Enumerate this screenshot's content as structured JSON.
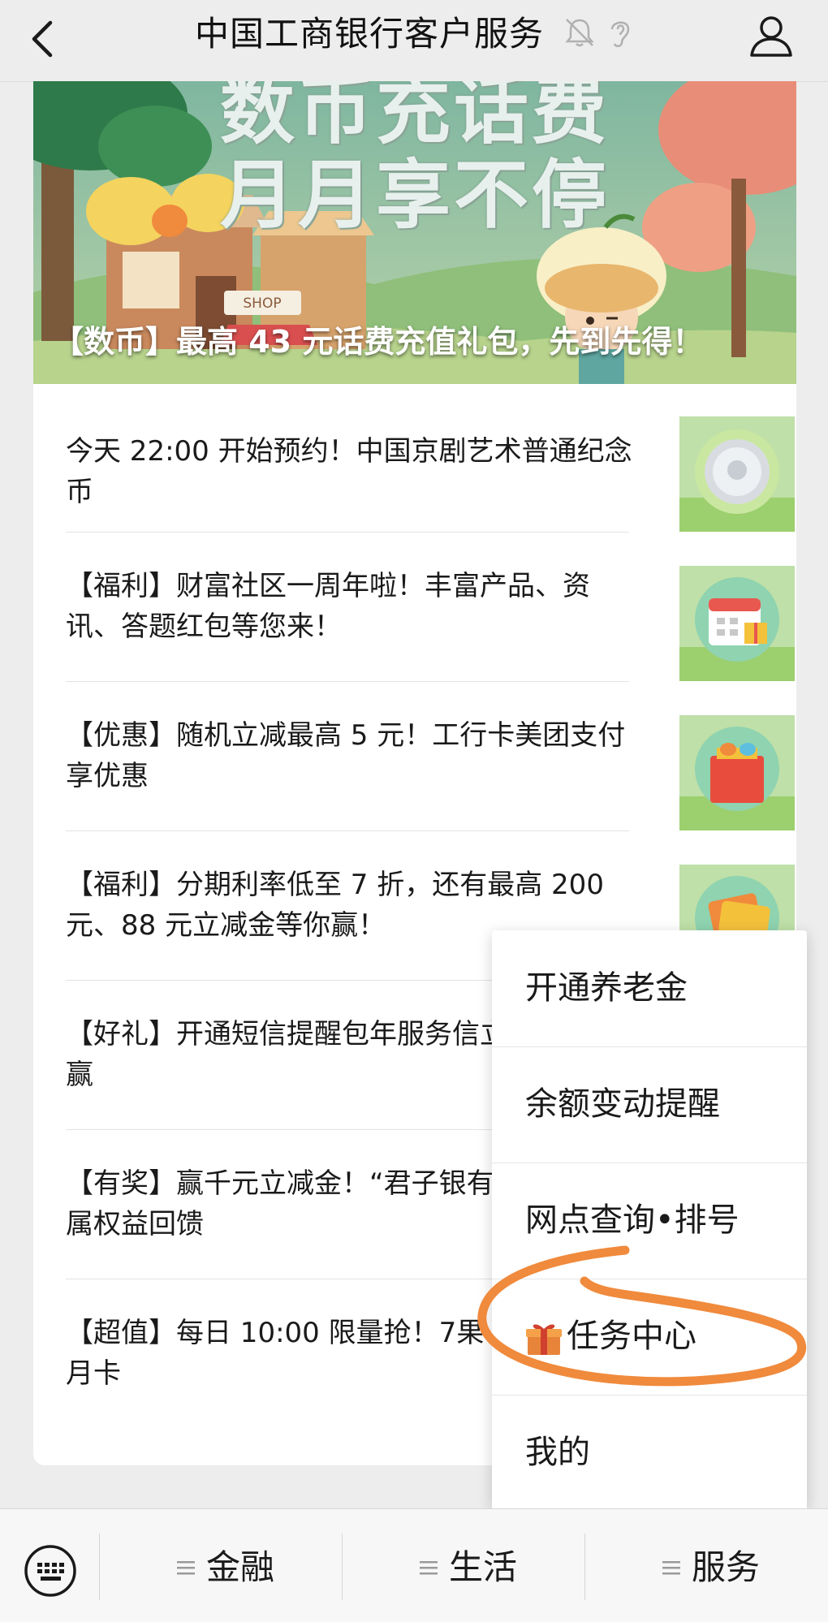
{
  "header": {
    "title": "中国工商银行客户服务",
    "icons": [
      "back-arrow-icon",
      "bell-muted-icon",
      "ear-icon",
      "person-icon"
    ]
  },
  "banner": {
    "headline_line1": "数币充话费",
    "headline_line2": "月月享不停",
    "caption": "【数币】最高 43 元话费充值礼包，先到先得！",
    "sign_text": "SHOP"
  },
  "articles": [
    {
      "text": "今天 22:00 开始预约！中国京剧艺术普通纪念币",
      "thumb": "commemorative-coin"
    },
    {
      "text": "【福利】财富社区一周年啦！丰富产品、资讯、答题红包等您来！",
      "thumb": "calendar-gift"
    },
    {
      "text": "【优惠】随机立减最高 5 元！工行卡美团支付享优惠",
      "thumb": "gift-bag"
    },
    {
      "text": "【福利】分期利率低至 7 折，还有最高 200 元、88 元立减金等你赢！",
      "thumb": "cards"
    },
    {
      "text": "【好礼】开通短信提醒包年服务信立减金等你赢",
      "thumb": ""
    },
    {
      "text": "【有奖】赢千元立减金！“君子银有礼”客户专属权益回馈",
      "thumb": ""
    },
    {
      "text": "【超值】每日 10:00 限量抢！7果 TV 会员双月卡",
      "thumb": ""
    }
  ],
  "menu": {
    "items": [
      {
        "label": "开通养老金"
      },
      {
        "label": "余额变动提醒"
      },
      {
        "label": "网点查询•排号"
      },
      {
        "label": "任务中心",
        "icon": "gift-icon"
      },
      {
        "label": "我的"
      }
    ]
  },
  "bottom_bar": {
    "keyboard_icon": "keyboard-icon",
    "tabs": [
      {
        "label": "金融"
      },
      {
        "label": "生活"
      },
      {
        "label": "服务"
      }
    ]
  },
  "colors": {
    "annotation": "#f08a3c",
    "background": "#ededed"
  }
}
